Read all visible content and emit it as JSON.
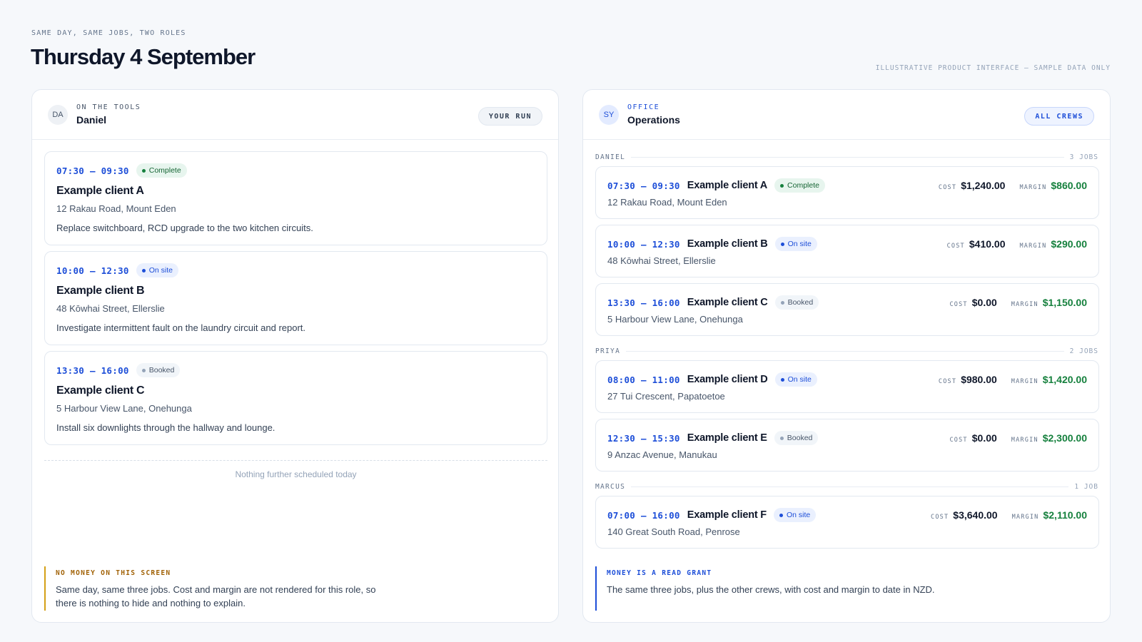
{
  "header": {
    "eyebrow": "SAME DAY, SAME JOBS, TWO ROLES",
    "title": "Thursday 4 September",
    "disclaimer": "ILLUSTRATIVE PRODUCT INTERFACE — SAMPLE DATA ONLY"
  },
  "left": {
    "avatar": "DA",
    "role": "ON THE TOOLS",
    "name": "Daniel",
    "button": "YOUR RUN",
    "jobs": [
      {
        "time": "07:30 – 09:30",
        "status": "Complete",
        "client": "Example client A",
        "address": "12 Rakau Road, Mount Eden",
        "description": "Replace switchboard, RCD upgrade to the two kitchen circuits."
      },
      {
        "time": "10:00 – 12:30",
        "status": "On site",
        "client": "Example client B",
        "address": "48 Kōwhai Street, Ellerslie",
        "description": "Investigate intermittent fault on the laundry circuit and report."
      },
      {
        "time": "13:30 – 16:00",
        "status": "Booked",
        "client": "Example client C",
        "address": "5 Harbour View Lane, Onehunga",
        "description": "Install six downlights through the hallway and lounge."
      }
    ],
    "nothing_text": "Nothing further scheduled today",
    "note": {
      "title": "NO MONEY ON THIS SCREEN",
      "body": "Same day, same three jobs. Cost and margin are not rendered for this role, so there is nothing to hide and nothing to explain."
    }
  },
  "right": {
    "avatar": "SY",
    "role": "OFFICE",
    "name": "Operations",
    "button": "ALL CREWS",
    "cost_label": "COST",
    "margin_label": "MARGIN",
    "groups": [
      {
        "name": "DANIEL",
        "count": "3 JOBS",
        "jobs": [
          {
            "time": "07:30 – 09:30",
            "client": "Example client A",
            "status": "Complete",
            "address": "12 Rakau Road, Mount Eden",
            "cost": "$1,240.00",
            "margin": "$860.00"
          },
          {
            "time": "10:00 – 12:30",
            "client": "Example client B",
            "status": "On site",
            "address": "48 Kōwhai Street, Ellerslie",
            "cost": "$410.00",
            "margin": "$290.00"
          },
          {
            "time": "13:30 – 16:00",
            "client": "Example client C",
            "status": "Booked",
            "address": "5 Harbour View Lane, Onehunga",
            "cost": "$0.00",
            "margin": "$1,150.00"
          }
        ]
      },
      {
        "name": "PRIYA",
        "count": "2 JOBS",
        "jobs": [
          {
            "time": "08:00 – 11:00",
            "client": "Example client D",
            "status": "On site",
            "address": "27 Tui Crescent, Papatoetoe",
            "cost": "$980.00",
            "margin": "$1,420.00"
          },
          {
            "time": "12:30 – 15:30",
            "client": "Example client E",
            "status": "Booked",
            "address": "9 Anzac Avenue, Manukau",
            "cost": "$0.00",
            "margin": "$2,300.00"
          }
        ]
      },
      {
        "name": "MARCUS",
        "count": "1 JOB",
        "jobs": [
          {
            "time": "07:00 – 16:00",
            "client": "Example client F",
            "status": "On site",
            "address": "140 Great South Road, Penrose",
            "cost": "$3,640.00",
            "margin": "$2,110.00"
          }
        ]
      }
    ],
    "note": {
      "title": "MONEY IS A READ GRANT",
      "body": "The same three jobs, plus the other crews, with cost and margin to date in NZD."
    }
  }
}
